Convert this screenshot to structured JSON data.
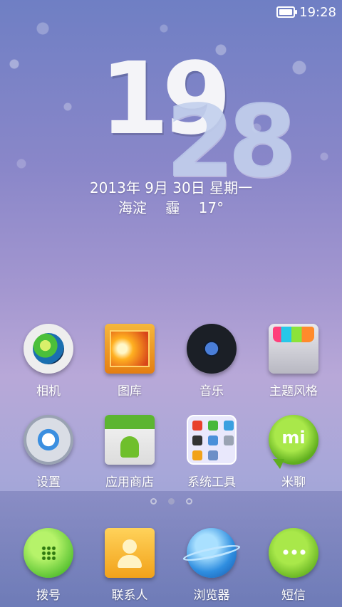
{
  "status_bar": {
    "time": "19:28",
    "battery_icon": "battery-icon"
  },
  "clock_widget": {
    "hours": "19",
    "minutes": "28",
    "date": "2013年 9月 30日 星期一",
    "location": "海淀",
    "weather": "霾",
    "temperature": "17°"
  },
  "apps": [
    {
      "label": "相机",
      "icon": "camera-icon"
    },
    {
      "label": "图库",
      "icon": "gallery-icon"
    },
    {
      "label": "音乐",
      "icon": "music-icon"
    },
    {
      "label": "主题风格",
      "icon": "theme-icon"
    },
    {
      "label": "设置",
      "icon": "settings-icon"
    },
    {
      "label": "应用商店",
      "icon": "app-store-icon"
    },
    {
      "label": "系统工具",
      "icon": "system-tools-folder-icon"
    },
    {
      "label": "米聊",
      "icon": "miliao-icon"
    }
  ],
  "miliao_icon_text": "mi",
  "page_indicator": {
    "pages": 3,
    "active": 2
  },
  "dock": [
    {
      "label": "拨号",
      "icon": "dialer-icon"
    },
    {
      "label": "联系人",
      "icon": "contacts-icon"
    },
    {
      "label": "浏览器",
      "icon": "browser-icon"
    },
    {
      "label": "短信",
      "icon": "sms-icon"
    }
  ],
  "colors": {
    "dock_bg": "#5a5fa0",
    "icon_green": "#5fae1e"
  }
}
